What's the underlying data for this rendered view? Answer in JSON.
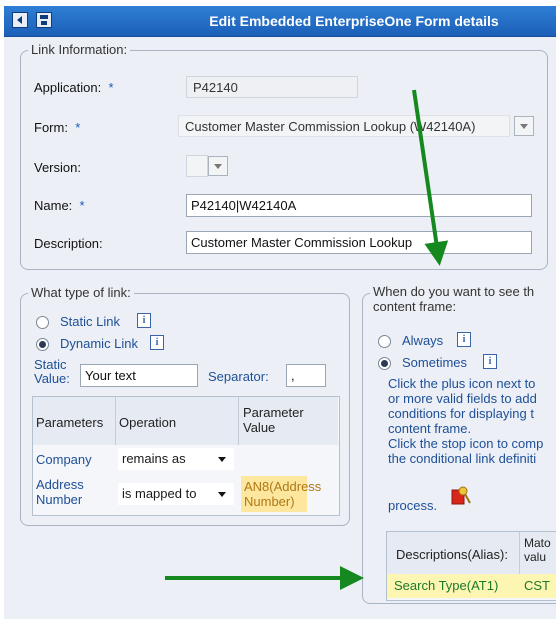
{
  "title": "Edit Embedded EnterpriseOne Form details",
  "link_info": {
    "legend": "Link Information:",
    "application_label": "Application:",
    "application_value": "P42140",
    "form_label": "Form:",
    "form_value": "Customer Master Commission Lookup (W42140A)",
    "version_label": "Version:",
    "name_label": "Name:",
    "name_value": "P42140|W42140A",
    "description_label": "Description:",
    "description_value": "Customer Master Commission Lookup",
    "required_mark": "*"
  },
  "link_type": {
    "legend": "What type of link:",
    "static_label": "Static Link",
    "dynamic_label": "Dynamic Link",
    "selected": "Dynamic Link",
    "static_value_label_1": "Static",
    "static_value_label_2": "Value:",
    "static_value": "Your text",
    "separator_label": "Separator:",
    "separator_value": ",",
    "table": {
      "col_parameters": "Parameters",
      "col_operation": "Operation",
      "col_value_1": "Parameter",
      "col_value_2": "Value",
      "rows": [
        {
          "param": "Company",
          "operation": "remains as",
          "value": ""
        },
        {
          "param_1": "Address",
          "param_2": "Number",
          "operation": "is mapped to",
          "value_1": "AN8(Address",
          "value_2": "Number)"
        }
      ]
    }
  },
  "when_see": {
    "legend_1": "When do you want to see th",
    "legend_2": "content frame:",
    "always_label": "Always",
    "sometimes_label": "Sometimes",
    "selected": "Sometimes",
    "help_lines": [
      "Click the plus icon next to",
      "or more valid fields to add",
      "conditions for displaying t",
      "content frame.",
      "Click the stop icon to comp",
      "the conditional link definiti"
    ],
    "process_label": "process.",
    "table": {
      "col_descriptions": "Descriptions(Alias):",
      "col_match_1": "Mato",
      "col_match_2": "valu",
      "row_desc": "Search Type(AT1)",
      "row_value": "CST"
    }
  },
  "info_glyph": "i",
  "colors": {
    "titlebar": "#1c5fb8",
    "arrow": "#15891f",
    "highlight": "#fde79e",
    "panel": "#ecf0f6"
  }
}
